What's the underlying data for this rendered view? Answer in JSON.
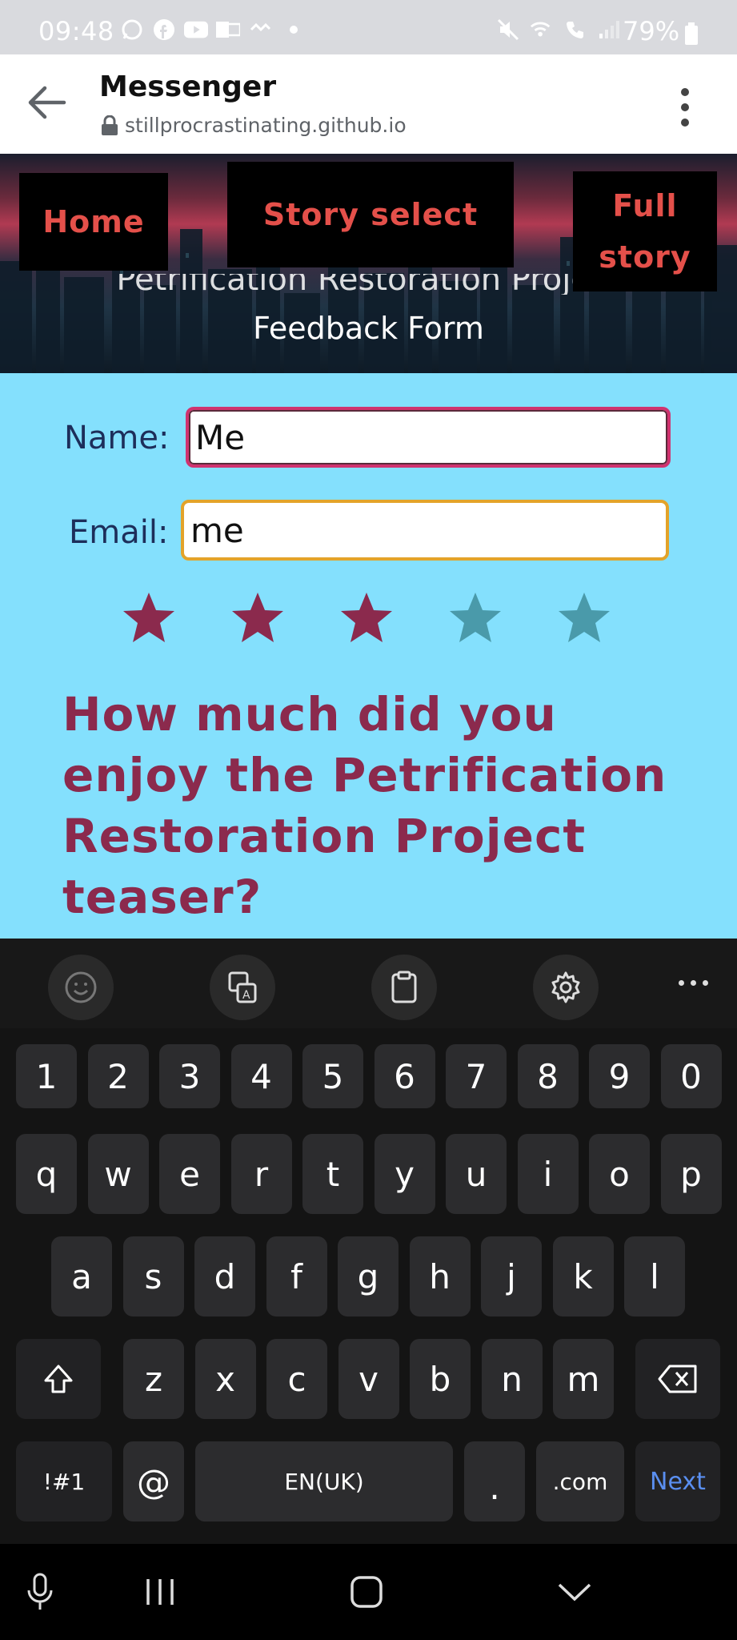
{
  "status_bar": {
    "time": "09:48",
    "battery": "79%"
  },
  "browser": {
    "app_title": "Messenger",
    "url": "stillprocrastinating.github.io"
  },
  "site": {
    "nav": {
      "home": "Home",
      "story_select": "Story select",
      "full_story_line1": "Full",
      "full_story_line2": "story"
    },
    "title_line1": "Petrification Restoration Project",
    "title_line2": "Feedback Form"
  },
  "form": {
    "name_label": "Name:",
    "name_value": "Me",
    "email_label": "Email:",
    "email_value": "me",
    "rating": 3,
    "rating_max": 5,
    "question": "How much did you enjoy the Petrification Restoration Project teaser?"
  },
  "keyboard": {
    "number_row": [
      "1",
      "2",
      "3",
      "4",
      "5",
      "6",
      "7",
      "8",
      "9",
      "0"
    ],
    "row1": [
      "q",
      "w",
      "e",
      "r",
      "t",
      "y",
      "u",
      "i",
      "o",
      "p"
    ],
    "row2": [
      "a",
      "s",
      "d",
      "f",
      "g",
      "h",
      "j",
      "k",
      "l"
    ],
    "row3": [
      "z",
      "x",
      "c",
      "v",
      "b",
      "n",
      "m"
    ],
    "symbols_key": "!#1",
    "at_key": "@",
    "space_label": "EN(UK)",
    "period_key": ".",
    "dotcom_key": ".com",
    "next_key": "Next"
  },
  "colors": {
    "form_bg": "#84e0fd",
    "star_filled": "#8b2a4d",
    "star_empty": "#4a9aaa",
    "nav_text": "#e4504a"
  }
}
